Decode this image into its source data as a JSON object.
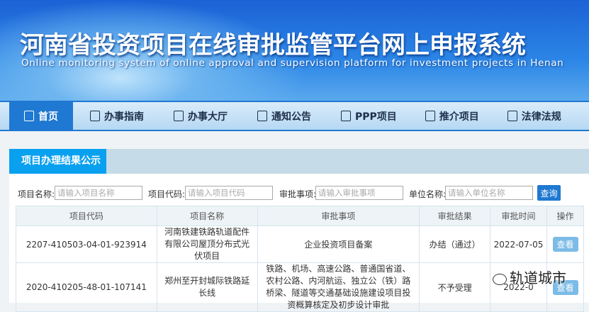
{
  "banner": {
    "title": "河南省投资项目在线审批监管平台网上申报系统",
    "subtitle": "Online monitoring system of online approval and supervision platform for investment projects in Henan"
  },
  "nav": [
    {
      "label": "首页",
      "icon": "home-icon"
    },
    {
      "label": "办事指南",
      "icon": "document-icon"
    },
    {
      "label": "办事大厅",
      "icon": "building-icon"
    },
    {
      "label": "通知公告",
      "icon": "notice-icon"
    },
    {
      "label": "PPP项目",
      "icon": "edit-icon"
    },
    {
      "label": "推介项目",
      "icon": "badge-icon"
    },
    {
      "label": "法律法规",
      "icon": "hands-icon"
    }
  ],
  "panel": {
    "title": "项目办理结果公示"
  },
  "filters": {
    "name_label": "项目名称:",
    "name_ph": "请输入项目名称",
    "code_label": "项目代码:",
    "code_ph": "请输入项目代码",
    "item_label": "审批事项:",
    "item_ph": "请输入审批事项",
    "unit_label": "单位名称:",
    "unit_ph": "请输入单位名称",
    "search": "查询"
  },
  "table": {
    "headers": [
      "项目代码",
      "项目名称",
      "审批事项",
      "审批结果",
      "审批时间",
      "操作"
    ],
    "rows": [
      {
        "code": "2207-410503-04-01-923914",
        "name": "河南铁建铁路轨道配件有限公司屋顶分布式光伏项目",
        "item": "企业投资项目备案",
        "result": "办结（通过）",
        "date": "2022-07-05",
        "action": "查看"
      },
      {
        "code": "2020-410205-48-01-107141",
        "name": "郑州至开封城际铁路延长线",
        "item": "铁路、机场、高速公路、普通国省道、农村公路、内河航运、独立公（铁）路桥梁、隧道等交通基础设施建设项目投资概算核定及初步设计审批",
        "result": "不予受理",
        "date": "2022-0",
        "action": "查看"
      }
    ]
  },
  "watermark": "轨道城市"
}
